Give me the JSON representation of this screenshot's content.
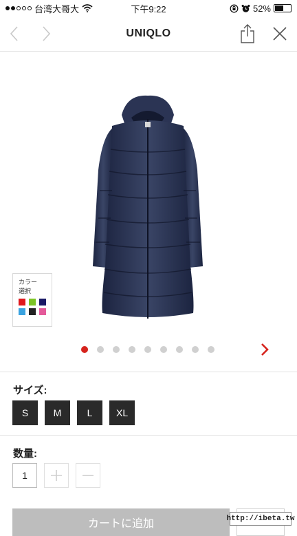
{
  "status_bar": {
    "carrier": "台湾大哥大",
    "time": "下午9:22",
    "battery": "52%",
    "battery_level": 0.52,
    "signal_bars_filled": 2,
    "signal_bars_total": 5
  },
  "nav": {
    "title": "UNIQLO",
    "back_icon": "chevron-left-icon",
    "forward_icon": "chevron-right-icon",
    "share_icon": "share-icon",
    "close_icon": "close-icon"
  },
  "product": {
    "image_icon": "navy-down-coat",
    "color_picker": {
      "label_line1": "カラー",
      "label_line2": "選択",
      "swatches": [
        "#e0171c",
        "#7dc526",
        "#1a1a66",
        "#3aa3e0",
        "#222222",
        "#e45a9a"
      ]
    },
    "carousel": {
      "total": 9,
      "active_index": 0,
      "next_icon": "chevron-right-icon",
      "accent": "#d6231d"
    }
  },
  "size_section": {
    "label": "サイズ:",
    "options": [
      "S",
      "M",
      "L",
      "XL"
    ]
  },
  "quantity_section": {
    "label": "数量:",
    "value": "1",
    "increment_icon": "plus-icon",
    "decrement_icon": "minus-icon"
  },
  "cart": {
    "label": "カートに追加"
  },
  "watermark": {
    "text": "http://ibeta.tw"
  }
}
